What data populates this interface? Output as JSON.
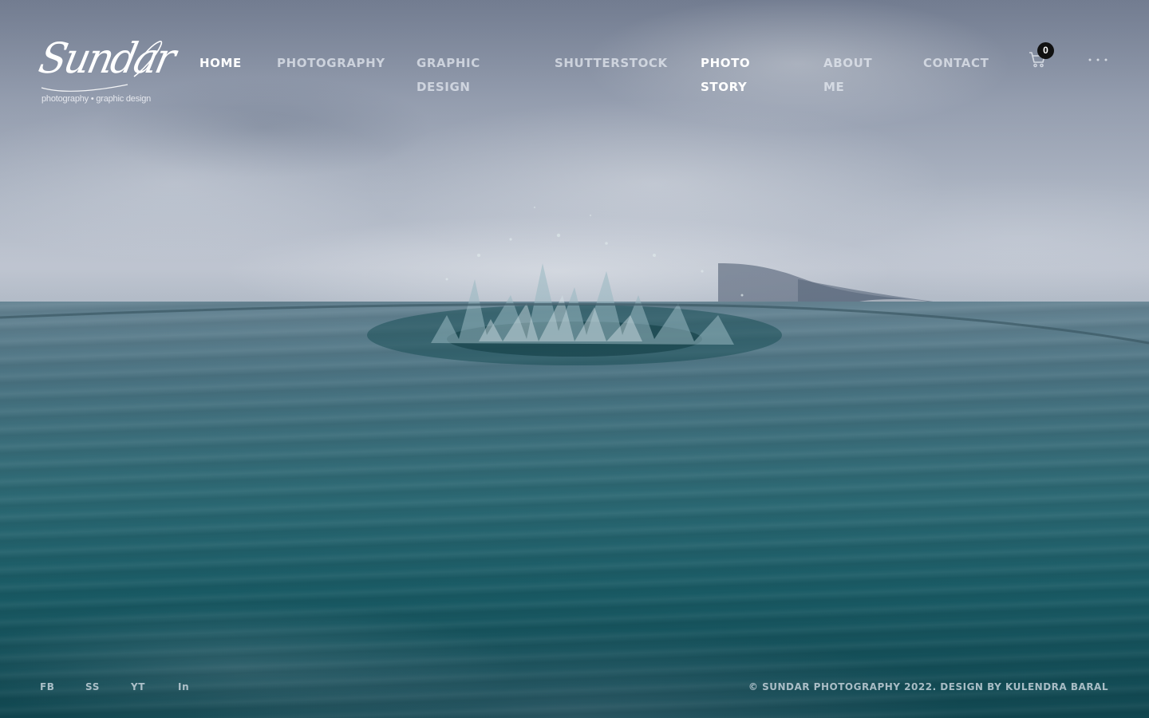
{
  "brand": {
    "logo_text": "Sundar",
    "tagline": "photography • graphic design"
  },
  "nav": {
    "items": [
      {
        "label": "HOME",
        "active": true
      },
      {
        "label": "PHOTOGRAPHY",
        "active": false
      },
      {
        "label": "GRAPHIC DESIGN",
        "active": false
      },
      {
        "label": "SHUTTERSTOCK",
        "active": false
      },
      {
        "label": "PHOTO STORY",
        "active": false
      },
      {
        "label": "ABOUT ME",
        "active": false
      },
      {
        "label": "CONTACT",
        "active": false
      }
    ]
  },
  "cart": {
    "icon": "shopping-cart-icon",
    "count": "0"
  },
  "menu": {
    "icon": "more-dots-icon"
  },
  "footer": {
    "social": [
      {
        "label": "FB"
      },
      {
        "label": "SS"
      },
      {
        "label": "YT"
      },
      {
        "label": "In"
      }
    ],
    "copyright": "© SUNDAR PHOTOGRAPHY 2022. DESIGN BY KULENDRA BARAL"
  },
  "colors": {
    "nav_active": "#ffffff",
    "nav_inactive": "#e8ecf2",
    "badge_bg": "#111111",
    "water": "#1d6670",
    "sky": "#aeb7c6"
  }
}
